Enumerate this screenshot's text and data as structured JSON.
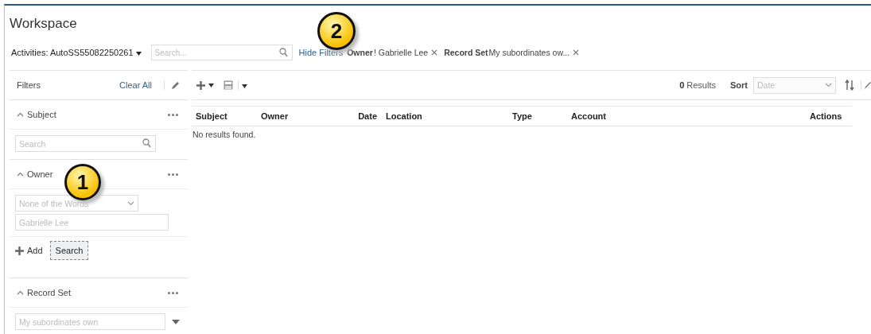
{
  "title": "Workspace",
  "callouts": [
    {
      "number": "2"
    },
    {
      "number": "1"
    }
  ],
  "toolbar": {
    "activities": "Activities: AutoSS55082250261",
    "search": {
      "placeholder": "Search..."
    },
    "hide_filters": "Hide Filters",
    "chips": [
      {
        "label": "Owner",
        "value": "! Gabrielle Lee"
      },
      {
        "label": "Record Set",
        "value": "My subordinates ow..."
      }
    ]
  },
  "filters": {
    "title": "Filters",
    "clear_all": "Clear All",
    "sections": [
      {
        "kind": "search",
        "title": "Subject",
        "expanded": true,
        "placeholder": "Search"
      },
      {
        "kind": "owner",
        "title": "Owner",
        "expanded": true,
        "operator": "None of the Words",
        "value": "Gabrielle Lee",
        "add": "Add",
        "search_button": "Search"
      },
      {
        "kind": "select",
        "title": "Record Set",
        "expanded": true,
        "value": "My subordinates own"
      }
    ]
  },
  "results": {
    "count": "0",
    "count_label": "Results",
    "sort_label": "Sort",
    "sort_value": "Date",
    "columns": [
      "Subject",
      "Owner",
      "Date",
      "Location",
      "Type",
      "Account",
      "Actions"
    ],
    "empty": "No results found."
  }
}
